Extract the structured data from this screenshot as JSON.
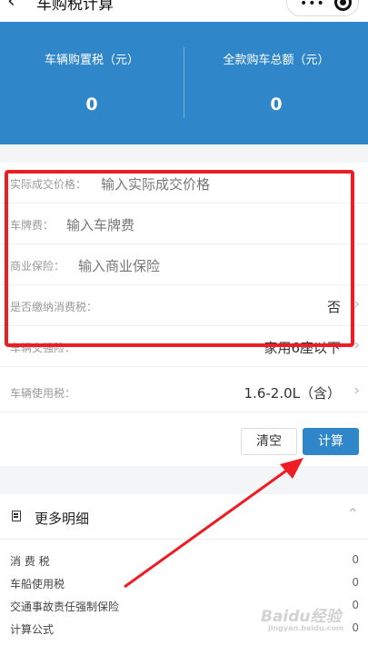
{
  "topbar": {
    "title": "车购税计算"
  },
  "summary": {
    "tax_label": "车辆购置税（元）",
    "tax_value": "0",
    "total_label": "全款购车总额（元）",
    "total_value": "0"
  },
  "form": {
    "price": {
      "label": "实际成交价格：",
      "placeholder": "输入实际成交价格"
    },
    "plate": {
      "label": "车牌费：",
      "placeholder": "输入车牌费"
    },
    "insurance": {
      "label": "商业保险：",
      "placeholder": "输入商业保险"
    },
    "consumption": {
      "label": "是否缴纳消费税：",
      "value": "否"
    },
    "compulsory": {
      "label": "车辆交强险：",
      "value": "家用6座以下"
    },
    "usage": {
      "label": "车辆使用税：",
      "value": "1.6-2.0L（含）"
    }
  },
  "buttons": {
    "clear": "清空",
    "calc": "计算"
  },
  "detail": {
    "title": "更多明细",
    "rows": [
      {
        "label": "消 费 税",
        "value": "0"
      },
      {
        "label": "车船使用税",
        "value": "0"
      },
      {
        "label": "交通事故责任强制保险",
        "value": "0"
      },
      {
        "label": "计算公式",
        "value": "0"
      }
    ]
  },
  "watermark": {
    "brand": "Baidu经验",
    "sub": "jingyan.baidu.com"
  },
  "colors": {
    "accent": "#2f86c8",
    "annotation": "#ee1d24"
  },
  "icons": {
    "back": "chevron-left-icon",
    "more": "more-dots-icon",
    "close": "target-icon",
    "detail": "document-icon",
    "collapse": "chevron-up-icon",
    "row": "chevron-right-icon"
  }
}
